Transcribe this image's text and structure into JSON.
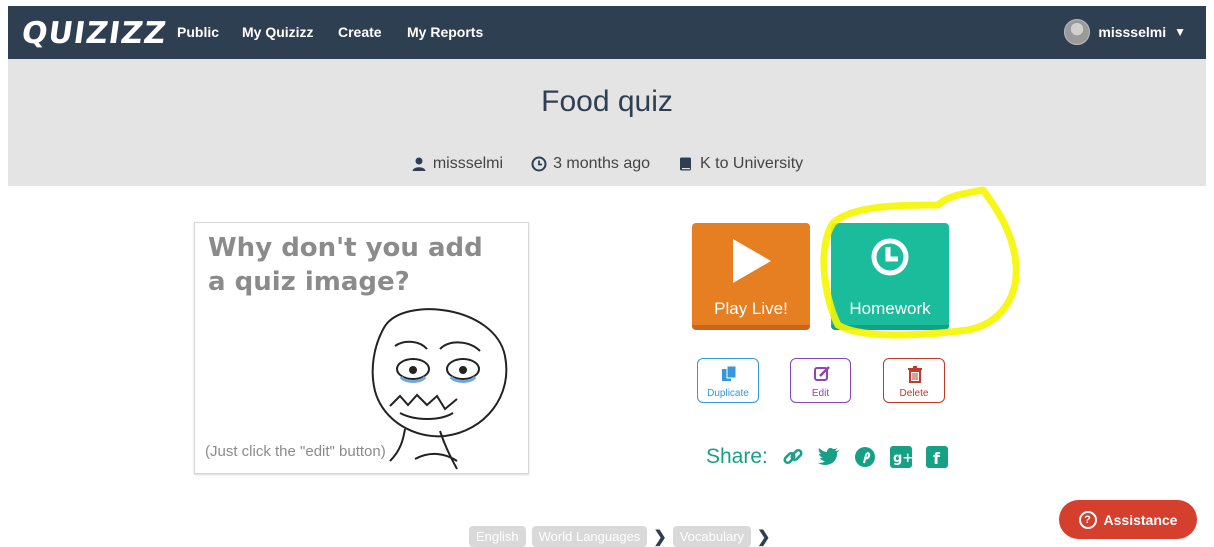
{
  "header": {
    "logo": "QUIZIZZ",
    "nav": [
      "Public",
      "My Quizizz",
      "Create",
      "My Reports"
    ],
    "username": "missselmi"
  },
  "quiz": {
    "title": "Food quiz",
    "author": "missselmi",
    "age": "3 months ago",
    "grade": "K to University"
  },
  "placeholder_image": {
    "headline": "Why don't you add a quiz image?",
    "hint": "(Just click the \"edit\" button)"
  },
  "actions": {
    "play_live": "Play Live!",
    "homework": "Homework",
    "duplicate": "Duplicate",
    "edit": "Edit",
    "delete": "Delete"
  },
  "share": {
    "label": "Share:",
    "icons": [
      "link-icon",
      "twitter-icon",
      "pinterest-icon",
      "google-plus-icon",
      "facebook-icon"
    ]
  },
  "tags": [
    "English",
    "World Languages",
    "Vocabulary"
  ],
  "assistance": {
    "label": "Assistance"
  },
  "colors": {
    "topbar": "#2f3f52",
    "play_live": "#e67e22",
    "homework": "#1abc9c",
    "duplicate": "#3498db",
    "edit": "#8e44ad",
    "delete": "#c0392b",
    "share": "#16a085",
    "assistance": "#d43f2e",
    "highlight": "#f5f500"
  }
}
